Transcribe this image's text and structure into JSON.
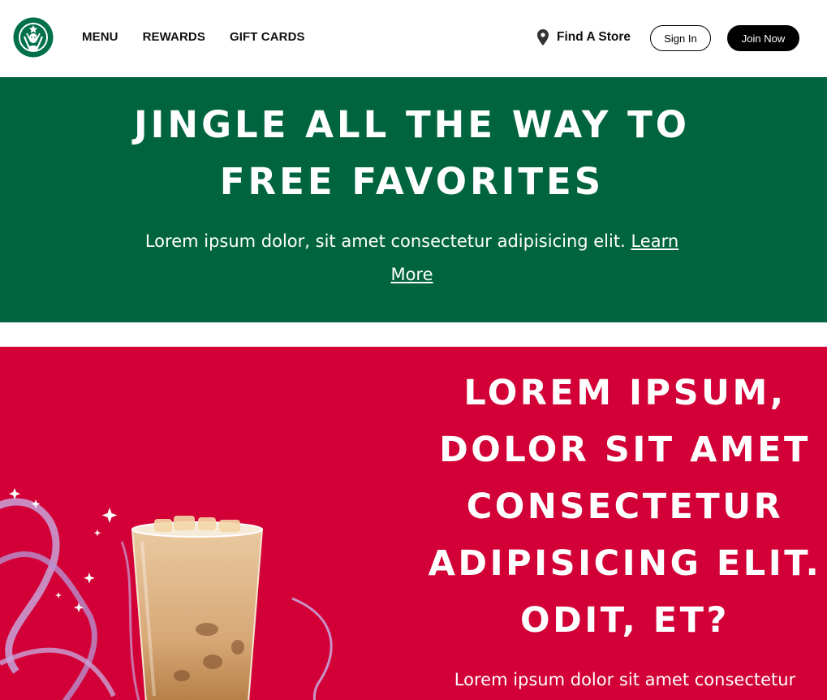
{
  "header": {
    "logo_icon": "starbucks-siren-logo-icon",
    "nav": [
      "MENU",
      "REWARDS",
      "GIFT CARDS"
    ],
    "find_store": {
      "icon": "location-pin-icon",
      "label": "Find A Store"
    },
    "sign_in": "Sign In",
    "join_now": "Join Now"
  },
  "hero": {
    "title": "JINGLE ALL THE WAY TO FREE FAVORITES",
    "text": "Lorem ipsum dolor, sit amet consectetur adipisicing elit.",
    "link": "Learn More",
    "background": "#00653f"
  },
  "promo": {
    "title": "LOREM IPSUM, DOLOR SIT AMET CONSECTETUR ADIPISICING ELIT. ODIT, ET?",
    "text": "Lorem ipsum dolor sit amet consectetur",
    "image_icon": "iced-coffee-drink-image",
    "background": "#d20036"
  }
}
